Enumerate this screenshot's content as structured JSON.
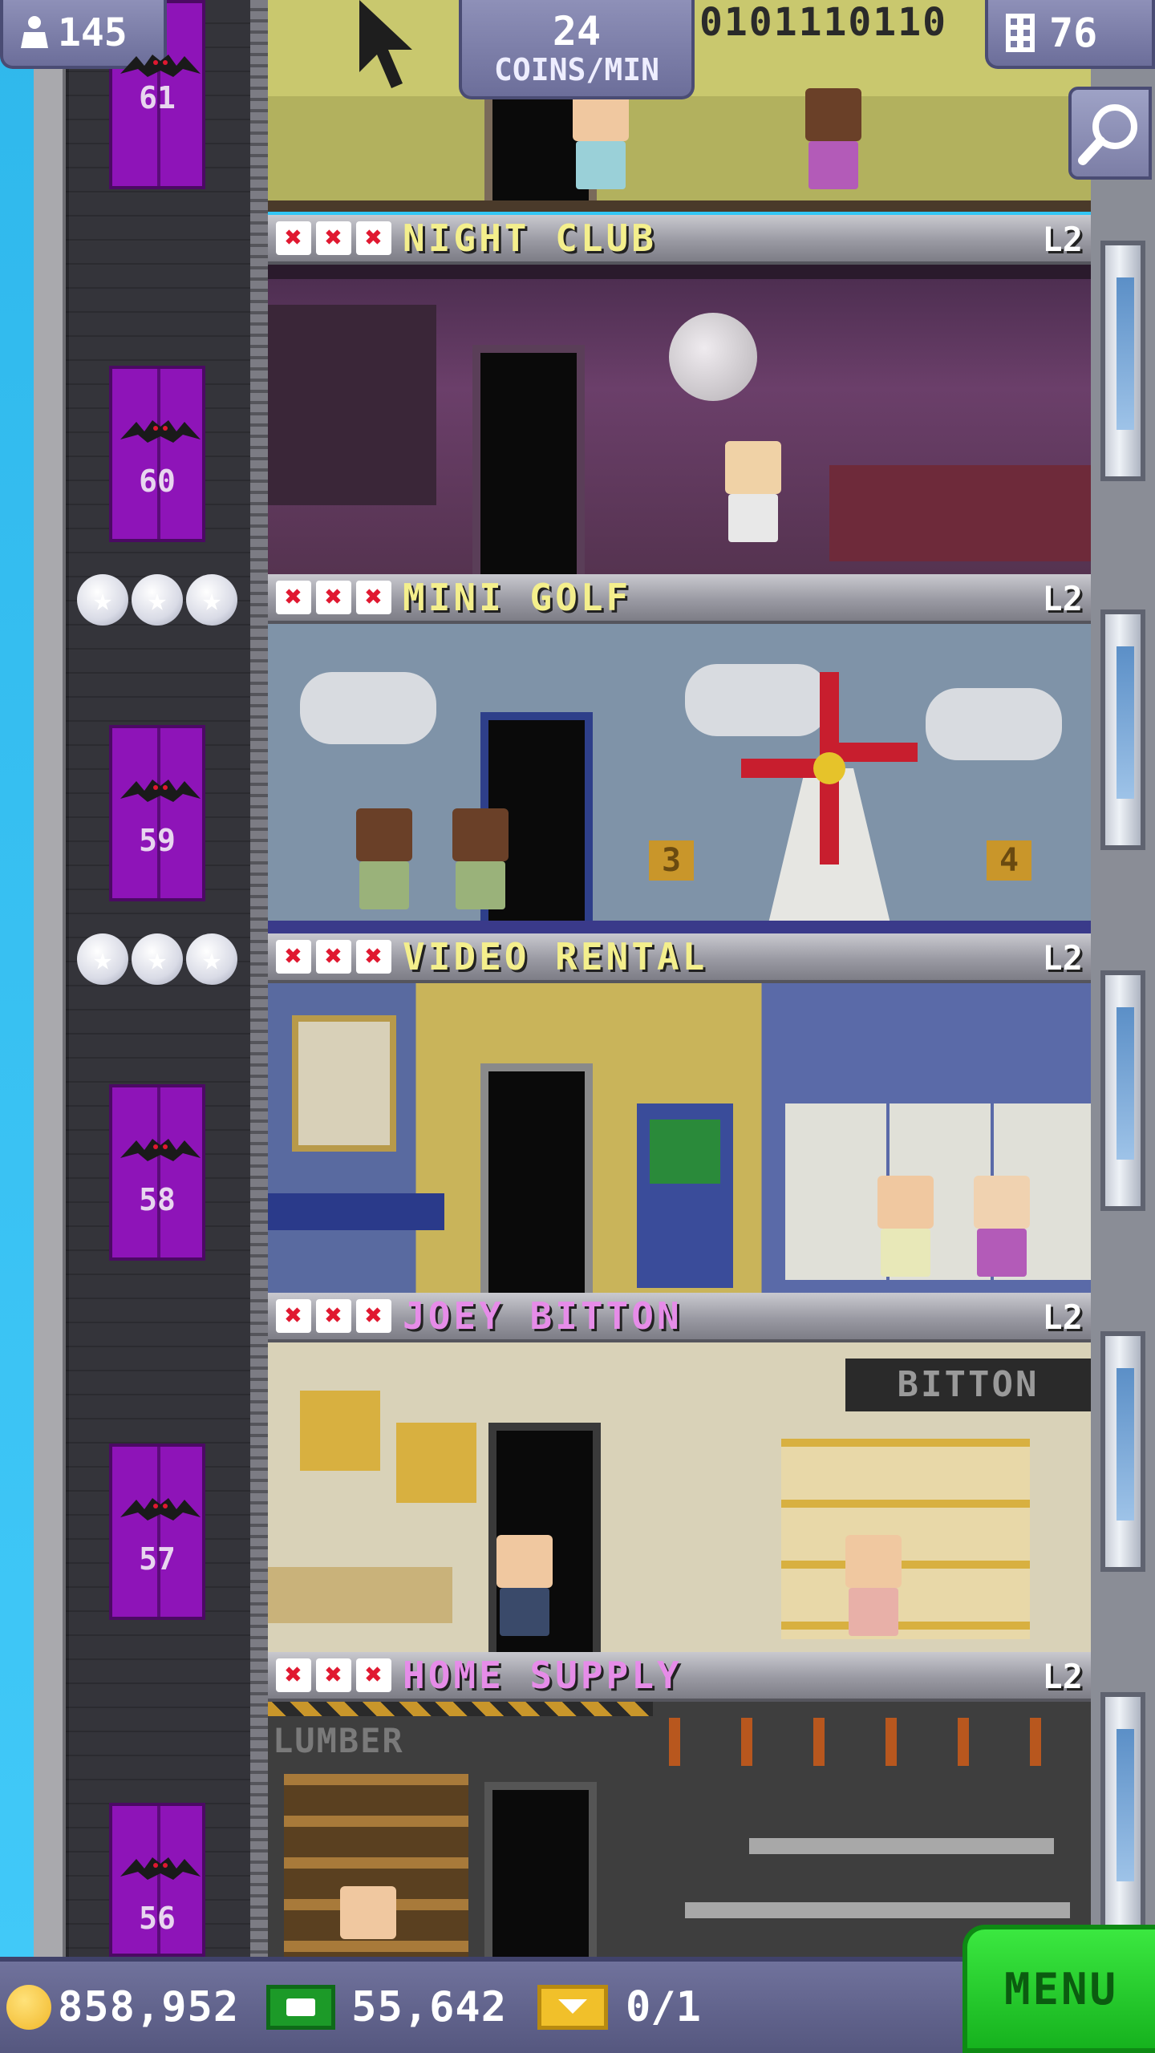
{
  "hud": {
    "population": "145",
    "coins_per_min_value": "24",
    "coins_per_min_label": "COINS/MIN",
    "binary_readout": "0101110110",
    "floors": "76"
  },
  "elevator_floors": [
    "61",
    "60",
    "59",
    "58",
    "57",
    "56"
  ],
  "rooms": [
    {
      "name": "NIGHT CLUB",
      "level": "L2",
      "name_color": "#f4ef8c"
    },
    {
      "name": "MINI GOLF",
      "level": "L2",
      "name_color": "#f4ef8c"
    },
    {
      "name": "VIDEO RENTAL",
      "level": "L2",
      "name_color": "#f4ef8c"
    },
    {
      "name": "JOEY BITTON",
      "level": "L2",
      "name_color": "#e68ce8",
      "sign": "BITTON"
    },
    {
      "name": "HOME SUPPLY",
      "level": "L2",
      "name_color": "#e68ce8",
      "sign": "LUMBER"
    }
  ],
  "golf_signs": [
    "3",
    "4"
  ],
  "footer": {
    "coins": "858,952",
    "bux": "55,642",
    "tickets": "0/1",
    "menu_label": "MENU"
  },
  "colors": {
    "elevator": "#8e14b8",
    "hud": "#7b7da8",
    "menu": "#22c92a"
  }
}
